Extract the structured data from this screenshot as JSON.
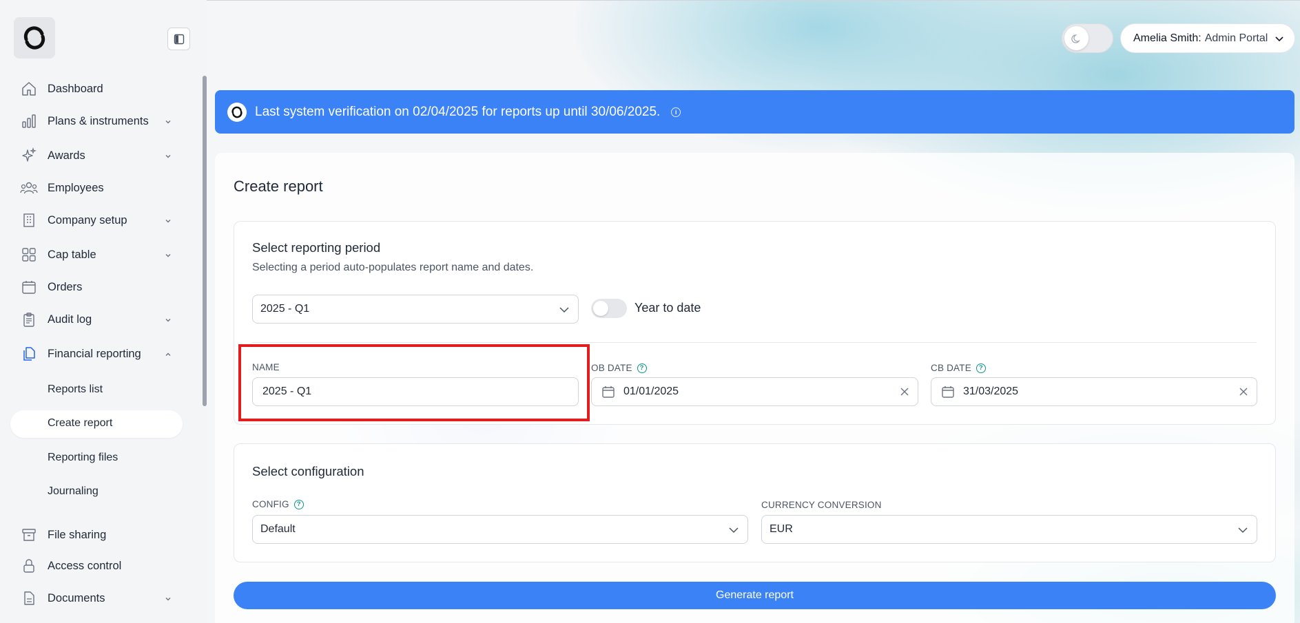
{
  "sidebar": {
    "items": [
      {
        "label": "Dashboard",
        "icon": "home-icon"
      },
      {
        "label": "Plans & instruments",
        "icon": "bar-chart-icon"
      },
      {
        "label": "Awards",
        "icon": "sparkle-icon"
      },
      {
        "label": "Employees",
        "icon": "users-icon"
      },
      {
        "label": "Company setup",
        "icon": "building-icon"
      },
      {
        "label": "Cap table",
        "icon": "grid-icon"
      },
      {
        "label": "Orders",
        "icon": "calendar-icon"
      },
      {
        "label": "Audit log",
        "icon": "clipboard-icon"
      },
      {
        "label": "Financial reporting",
        "icon": "documents-icon"
      },
      {
        "label": "File sharing",
        "icon": "archive-icon"
      },
      {
        "label": "Access control",
        "icon": "lock-icon"
      },
      {
        "label": "Documents",
        "icon": "file-icon"
      }
    ],
    "sub_items": [
      "Reports list",
      "Create report",
      "Reporting files",
      "Journaling"
    ]
  },
  "header": {
    "user_name": "Amelia Smith:",
    "portal": "Admin Portal"
  },
  "banner": {
    "text": "Last system verification on 02/04/2025 for reports up until 30/06/2025."
  },
  "page": {
    "title": "Create report"
  },
  "period": {
    "title": "Select reporting period",
    "subtitle": "Selecting a period auto-populates report name and dates.",
    "selected": "2025 - Q1",
    "ytd_label": "Year to date",
    "name_label": "NAME",
    "name_value": "2025 - Q1",
    "ob_label": "OB DATE",
    "ob_value": "01/01/2025",
    "cb_label": "CB DATE",
    "cb_value": "31/03/2025"
  },
  "config": {
    "title": "Select configuration",
    "config_label": "CONFIG",
    "config_value": "Default",
    "currency_label": "CURRENCY CONVERSION",
    "currency_value": "EUR"
  },
  "actions": {
    "generate": "Generate report"
  },
  "colors": {
    "accent": "#3b82f6",
    "highlight": "#e11d1d",
    "help": "#0d9488"
  }
}
